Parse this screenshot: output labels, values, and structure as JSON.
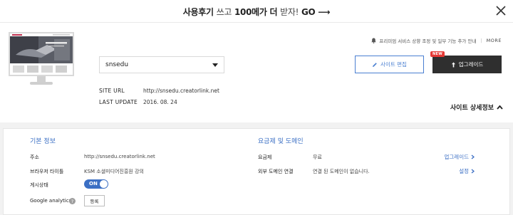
{
  "promo": {
    "part1": "사용후기",
    "part2": "쓰고",
    "part3": "100메가 더",
    "part4": "받자!",
    "part5": "GO",
    "arrow": "⟶"
  },
  "notice": {
    "text": "프리미엄 서비스 상향 조정 및 일부 기능 추가 안내",
    "sep": "|",
    "more": "MORE"
  },
  "site": {
    "selected": "snsedu",
    "url_label": "SITE URL",
    "url_value": "http://snsedu.creatorlink.net",
    "update_label": "LAST UPDATE",
    "update_value": "2016. 08. 24"
  },
  "buttons": {
    "edit": "사이트 편집",
    "upgrade": "업그레이드",
    "new_badge": "NEW"
  },
  "detail_toggle": {
    "label": "사이트 상세정보"
  },
  "basic": {
    "title": "기본 정보",
    "address_label": "주소",
    "address_value": "http://snsedu.creatorlink.net",
    "browser_title_label": "브라우저 타이틀",
    "browser_title_value": "KSM 소셜미디어진흥원 강의",
    "publish_label": "게시상태",
    "publish_value": "ON",
    "ga_label": "Google analytics",
    "ga_button": "등록"
  },
  "plan": {
    "title": "요금제 및 도메인",
    "plan_label": "요금제",
    "plan_value": "무료",
    "plan_link": "업그레이드",
    "domain_label": "외부 도메인 연결",
    "domain_value": "연결 된 도메인이 없습니다.",
    "domain_link": "설정"
  },
  "colors": {
    "accent": "#3b6fc4",
    "dark_button": "#2f2f2f",
    "badge": "#e53935"
  }
}
